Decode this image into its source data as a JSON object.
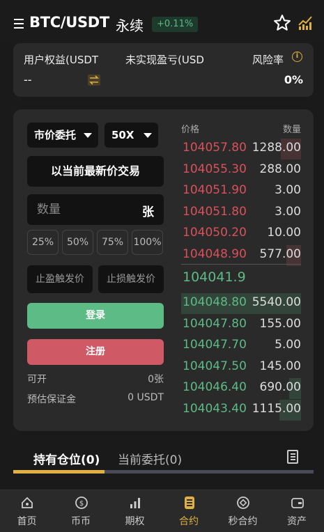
{
  "header": {
    "pair": "BTC/USDT",
    "contract_type": "永续",
    "change": "+0.11%",
    "colors": {
      "up": "#5dbb86",
      "down": "#d9515b",
      "accent": "#e0b040"
    }
  },
  "account": {
    "equity_label": "用户权益(USDT",
    "equity_value": "--",
    "unrealized_label": "未实现盈亏(USD",
    "risk_label": "风险率",
    "risk_value": "0%"
  },
  "form": {
    "order_type": "市价委托",
    "leverage": "50X",
    "market_button": "以当前最新价交易",
    "qty_placeholder": "数量",
    "qty_unit": "张",
    "percentages": [
      "25%",
      "50%",
      "75%",
      "100%"
    ],
    "take_profit_placeholder": "止盈触发价",
    "stop_loss_placeholder": "止损触发价",
    "login": "登录",
    "register": "注册",
    "available_label": "可开",
    "available_value": "0张",
    "margin_label": "预估保证金",
    "margin_value": "0 USDT"
  },
  "orderbook": {
    "price_header": "价格",
    "qty_header": "数量",
    "asks": [
      {
        "price": "104057.80",
        "qty": "1288.00",
        "depth": 0.17
      },
      {
        "price": "104055.30",
        "qty": "288.00",
        "depth": 0.0
      },
      {
        "price": "104051.90",
        "qty": "3.00",
        "depth": 0.0
      },
      {
        "price": "104051.80",
        "qty": "3.00",
        "depth": 0.0
      },
      {
        "price": "104050.20",
        "qty": "10.00",
        "depth": 0.0
      },
      {
        "price": "104048.90",
        "qty": "577.00",
        "depth": 0.12
      }
    ],
    "last_price": "104041.9",
    "bids": [
      {
        "price": "104048.80",
        "qty": "5540.00",
        "depth": 1.0
      },
      {
        "price": "104047.80",
        "qty": "155.00",
        "depth": 0.0
      },
      {
        "price": "104047.70",
        "qty": "5.00",
        "depth": 0.0
      },
      {
        "price": "104047.50",
        "qty": "145.00",
        "depth": 0.0
      },
      {
        "price": "104046.40",
        "qty": "690.00",
        "depth": 0.1
      },
      {
        "price": "104043.40",
        "qty": "1115.00",
        "depth": 0.18
      }
    ]
  },
  "tabs": {
    "positions": "持有仓位(0)",
    "orders": "当前委托(0)"
  },
  "nav": [
    {
      "label": "首页",
      "icon": "home-icon"
    },
    {
      "label": "币币",
      "icon": "coin-icon"
    },
    {
      "label": "期权",
      "icon": "signal-bars-icon"
    },
    {
      "label": "合约",
      "icon": "contract-icon",
      "active": true
    },
    {
      "label": "秒合约",
      "icon": "diamond-icon"
    },
    {
      "label": "资产",
      "icon": "wallet-icon"
    }
  ]
}
